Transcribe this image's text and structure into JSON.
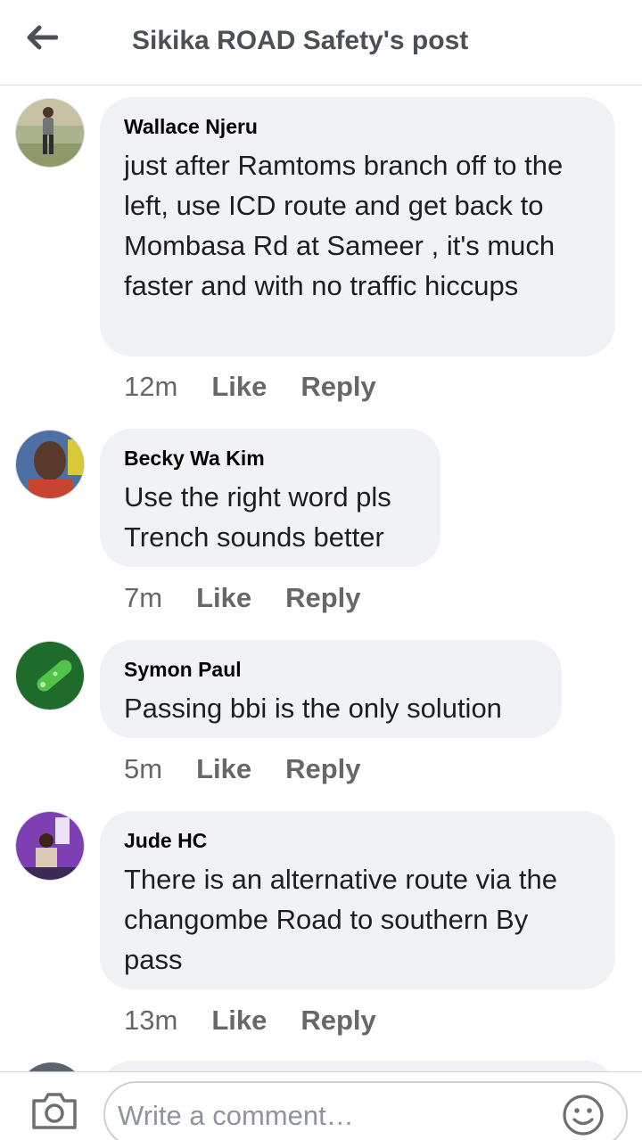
{
  "header": {
    "title": "Sikika ROAD Safety's post",
    "back_icon": "arrow-left-icon"
  },
  "comments": [
    {
      "author": "Wallace Njeru",
      "text": " just after Ramtoms branch off to the left, use ICD route and get back to Mombasa Rd at Sameer , it's much faster and with no traffic hiccups",
      "time": "12m",
      "like_label": "Like",
      "reply_label": "Reply"
    },
    {
      "author": "Becky Wa Kim",
      "text": "Use the right word pls Trench sounds better",
      "time": "7m",
      "like_label": "Like",
      "reply_label": "Reply"
    },
    {
      "author": "Symon Paul",
      "text": "Passing bbi is the only solution",
      "time": "5m",
      "like_label": "Like",
      "reply_label": "Reply"
    },
    {
      "author": "Jude HC",
      "text": "There is an alternative route via the changombe Road to southern By pass",
      "time": "13m",
      "like_label": "Like",
      "reply_label": "Reply"
    }
  ],
  "composer": {
    "placeholder": "Write a comment…",
    "camera_icon": "camera-icon",
    "emoji_icon": "emoji-icon"
  },
  "colors": {
    "bubble": "#f0f2f5",
    "meta_text": "#65676b",
    "title_text": "#4b4f56"
  }
}
